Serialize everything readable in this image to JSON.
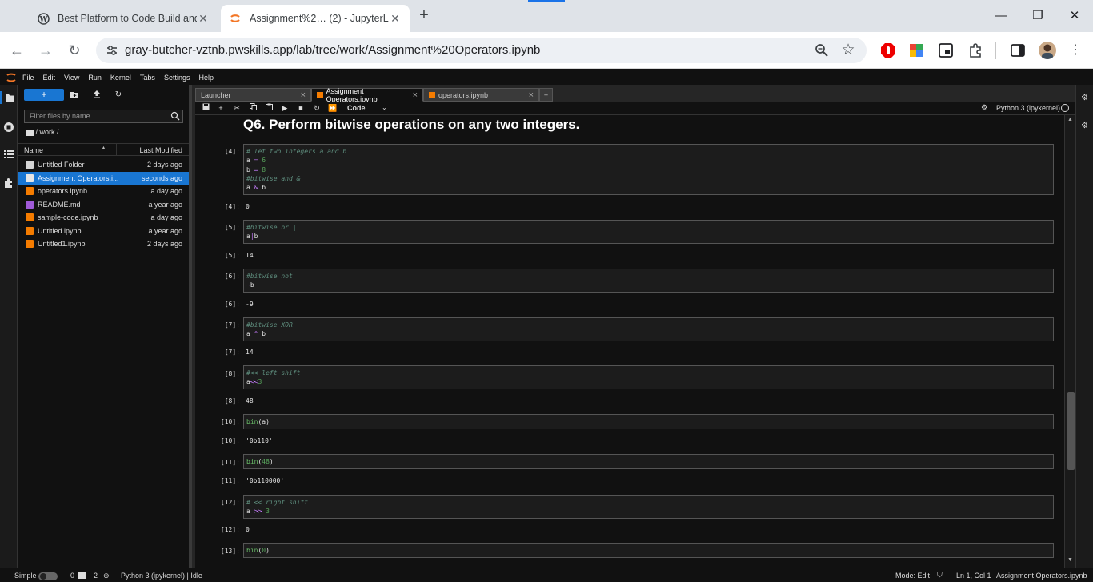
{
  "browser": {
    "tabs": [
      {
        "title": "Best Platform to Code Build and",
        "active": false
      },
      {
        "title": "Assignment%2… (2) - JupyterLa",
        "active": true
      }
    ],
    "new_tab": "+",
    "window_controls": {
      "minimize": "—",
      "maximize": "❐",
      "close": "✕"
    },
    "url": "gray-butcher-vztnb.pwskills.app/lab/tree/work/Assignment%20Operators.ipynb"
  },
  "menu": [
    "File",
    "Edit",
    "View",
    "Run",
    "Kernel",
    "Tabs",
    "Settings",
    "Help"
  ],
  "filebrowser": {
    "new_button": "+",
    "filter_placeholder": "Filter files by name",
    "path": "/ work /",
    "col_name": "Name",
    "col_modified": "Last Modified",
    "files": [
      {
        "name": "Untitled Folder",
        "modified": "2 days ago",
        "kind": "folder",
        "color": "#d4d4d4"
      },
      {
        "name": "Assignment Operators.i...",
        "modified": "seconds ago",
        "kind": "notebook",
        "color": "#e6e6e6",
        "selected": true
      },
      {
        "name": "operators.ipynb",
        "modified": "a day ago",
        "kind": "notebook",
        "color": "#f57c00"
      },
      {
        "name": "README.md",
        "modified": "a year ago",
        "kind": "markdown",
        "color": "#a05ad8"
      },
      {
        "name": "sample-code.ipynb",
        "modified": "a day ago",
        "kind": "notebook",
        "color": "#f57c00"
      },
      {
        "name": "Untitled.ipynb",
        "modified": "a year ago",
        "kind": "notebook",
        "color": "#f57c00"
      },
      {
        "name": "Untitled1.ipynb",
        "modified": "2 days ago",
        "kind": "notebook",
        "color": "#f57c00"
      }
    ]
  },
  "doc_tabs": [
    {
      "label": "Launcher"
    },
    {
      "label": "Assignment Operators.ipynb"
    },
    {
      "label": "operators.ipynb"
    }
  ],
  "notebook": {
    "cell_type": "Code",
    "kernel": "Python 3 (ipykernel)",
    "heading": "Q6. Perform bitwise operations on any two integers.",
    "cells": [
      {
        "in": "[4]:",
        "out_prompt": "[4]:",
        "out": "0"
      },
      {
        "in": "[5]:",
        "out_prompt": "[5]:",
        "out": "14"
      },
      {
        "in": "[6]:",
        "out_prompt": "[6]:",
        "out": "-9"
      },
      {
        "in": "[7]:",
        "out_prompt": "[7]:",
        "out": "14"
      },
      {
        "in": "[8]:",
        "out_prompt": "[8]:",
        "out": "48"
      },
      {
        "in": "[10]:",
        "out_prompt": "[10]:",
        "out": "'0b110'"
      },
      {
        "in": "[11]:",
        "out_prompt": "[11]:",
        "out": "'0b110000'"
      },
      {
        "in": "[12]:",
        "out_prompt": "[12]:",
        "out": "0"
      },
      {
        "in": "[13]:"
      }
    ],
    "code": {
      "c4": {
        "l1": "# let two integers a and b",
        "l2a": "a ",
        "l2op": "=",
        "l2n": " 6",
        "l3a": "b ",
        "l3op": "=",
        "l3n": " 8",
        "l4": "#bitwise and &",
        "l5a": "a ",
        "l5op": "&",
        "l5b": " b"
      },
      "c5": {
        "l1": "#bitwise or |",
        "l2a": "a",
        "l2op": "|",
        "l2b": "b"
      },
      "c6": {
        "l1": "#bitwise not",
        "l2op": "~",
        "l2b": "b"
      },
      "c7": {
        "l1": "#bitwise XOR",
        "l2a": "a ",
        "l2op": "^",
        "l2b": " b"
      },
      "c8": {
        "l1": "#<< left shift",
        "l2a": "a",
        "l2op": "<<",
        "l2n": "3"
      },
      "c10": {
        "fn": "bin",
        "arg": "(a)"
      },
      "c11": {
        "fn": "bin",
        "p1": "(",
        "n": "48",
        "p2": ")"
      },
      "c12": {
        "l1": "# << right shift",
        "l2a": "a ",
        "l2op": ">>",
        "l2n": " 3"
      },
      "c13": {
        "fn": "bin",
        "p1": "(",
        "n": "0",
        "p2": ")"
      }
    }
  },
  "status": {
    "mode_label": "Simple",
    "count_a": "0",
    "count_b": "2",
    "kernel_status": "Python 3 (ipykernel) | Idle",
    "mode": "Mode: Edit",
    "position": "Ln 1, Col 1",
    "file": "Assignment Operators.ipynb"
  }
}
